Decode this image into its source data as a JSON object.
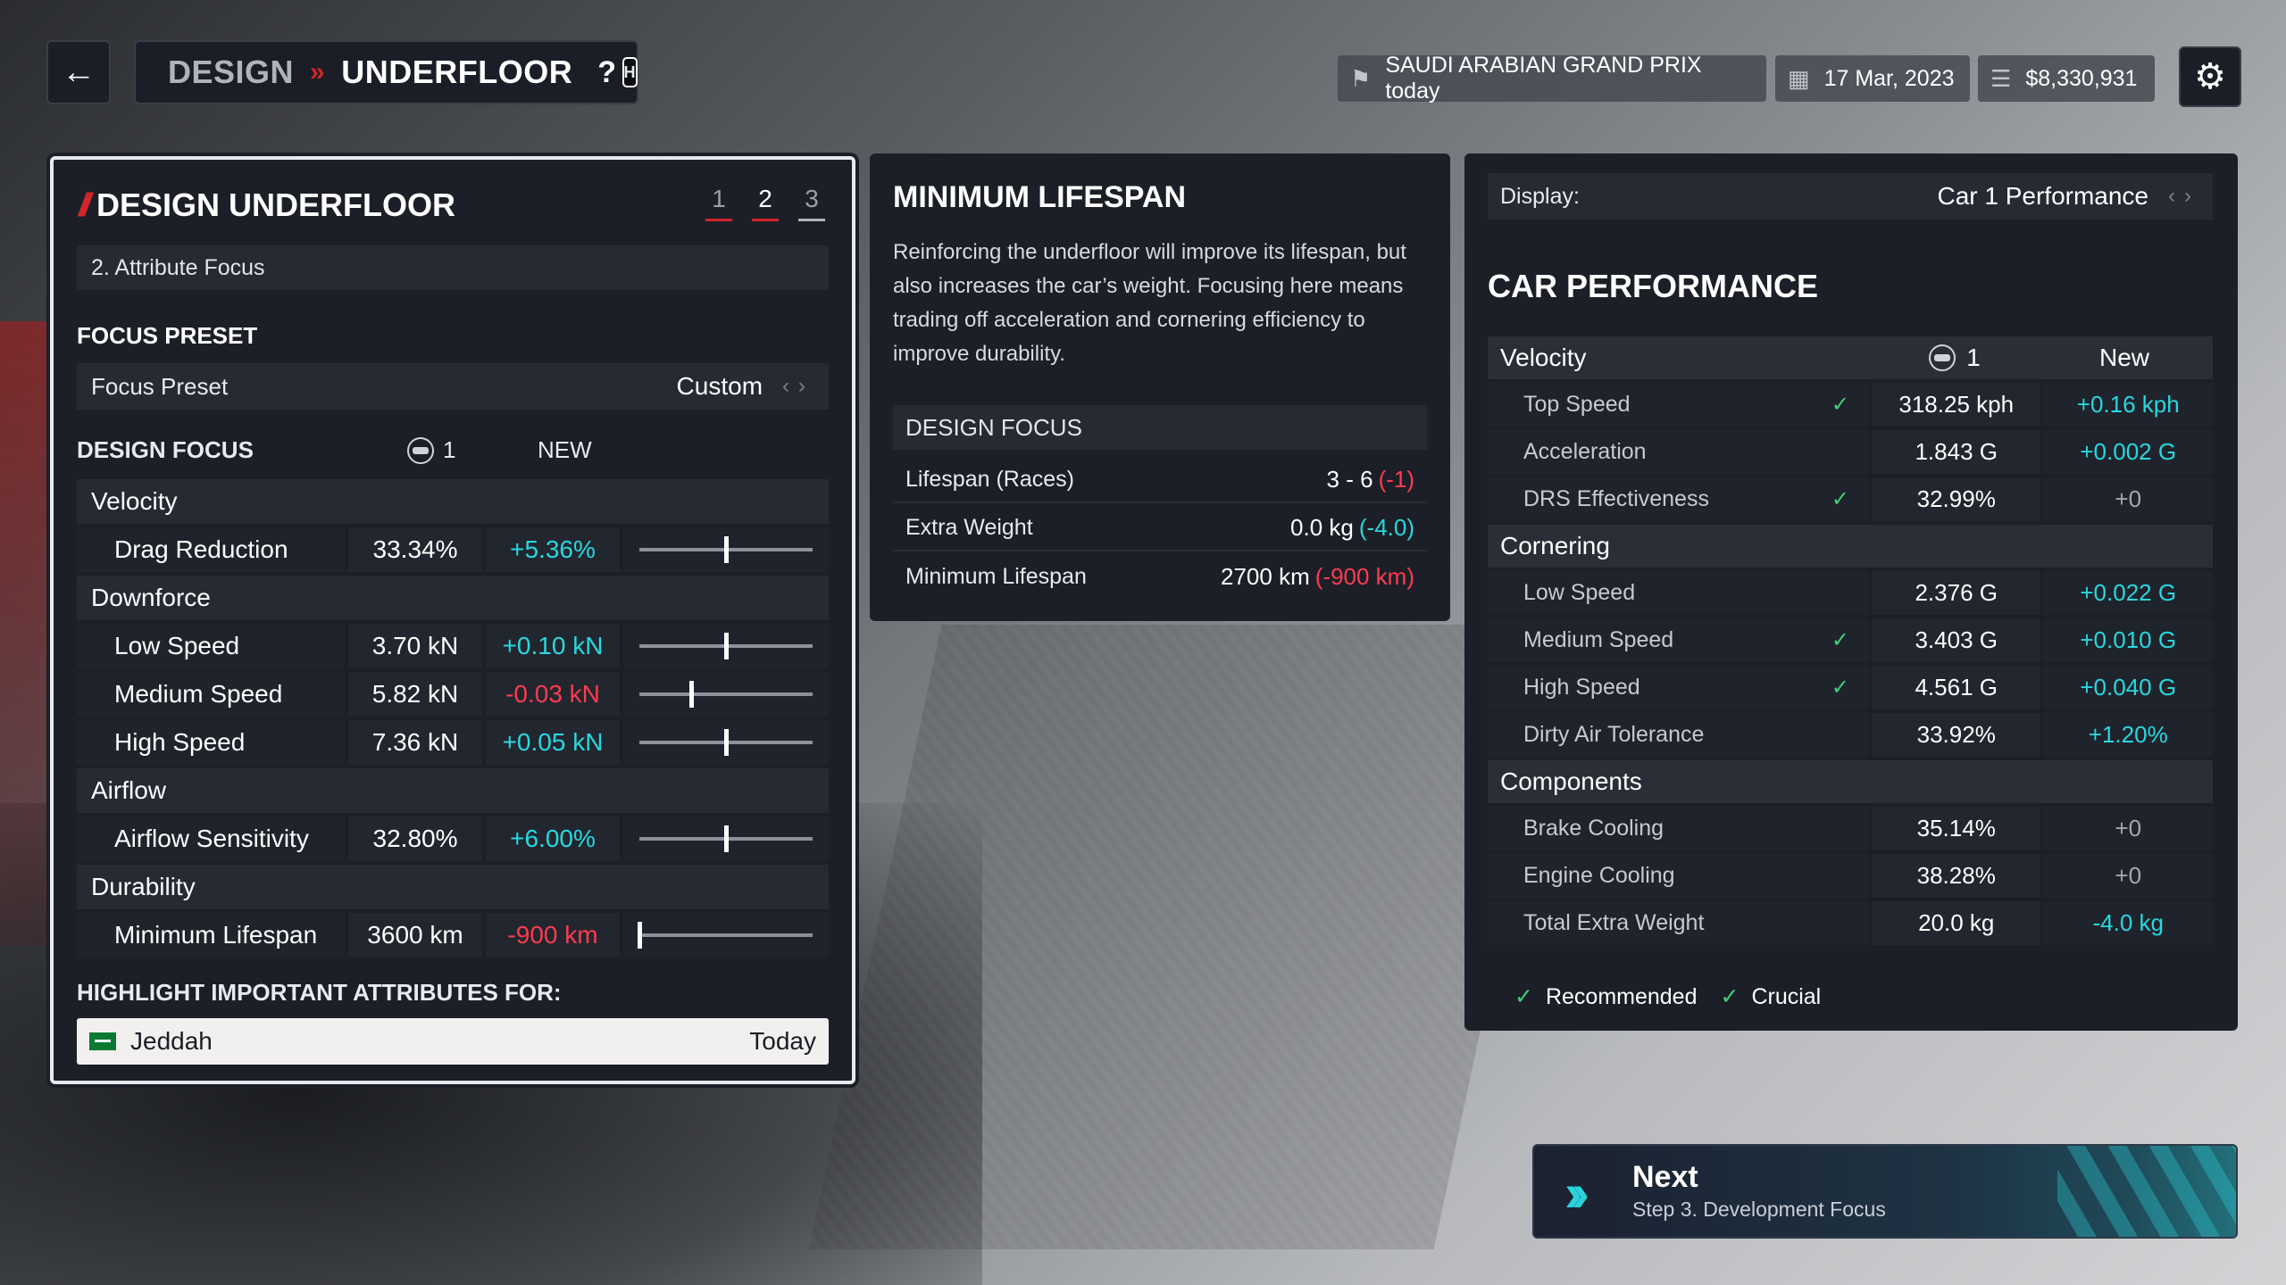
{
  "header": {
    "back_icon": "arrow-left-icon",
    "crumb1": "DESIGN",
    "separator": "»",
    "crumb2": "UNDERFLOOR",
    "help": "?",
    "help_key": "H",
    "event": "SAUDI ARABIAN GRAND PRIX today",
    "date": "17 Mar, 2023",
    "money": "$8,330,931",
    "settings_icon": "gear-icon"
  },
  "design_panel": {
    "title": "DESIGN UNDERFLOOR",
    "steps": [
      "1",
      "2",
      "3"
    ],
    "active_step": "2",
    "subhead": "2. Attribute Focus",
    "focus_preset_section": "FOCUS PRESET",
    "focus_preset_label": "Focus Preset",
    "focus_preset_value": "Custom",
    "design_focus_label": "DESIGN FOCUS",
    "driver_col": "1",
    "new_col": "NEW",
    "groups": [
      {
        "name": "Velocity",
        "rows": [
          {
            "name": "Drag Reduction",
            "base": "33.34%",
            "delta": "+5.36%",
            "trend": "pos",
            "slider": 0.5
          }
        ]
      },
      {
        "name": "Downforce",
        "rows": [
          {
            "name": "Low Speed",
            "base": "3.70 kN",
            "delta": "+0.10 kN",
            "trend": "pos",
            "slider": 0.5
          },
          {
            "name": "Medium Speed",
            "base": "5.82 kN",
            "delta": "-0.03 kN",
            "trend": "neg",
            "slider": 0.3
          },
          {
            "name": "High Speed",
            "base": "7.36 kN",
            "delta": "+0.05 kN",
            "trend": "pos",
            "slider": 0.5
          }
        ]
      },
      {
        "name": "Airflow",
        "rows": [
          {
            "name": "Airflow Sensitivity",
            "base": "32.80%",
            "delta": "+6.00%",
            "trend": "pos",
            "slider": 0.5
          }
        ]
      },
      {
        "name": "Durability",
        "rows": [
          {
            "name": "Minimum Lifespan",
            "base": "3600 km",
            "delta": "-900 km",
            "trend": "neg",
            "slider": 0.0
          }
        ]
      }
    ],
    "highlight_label": "HIGHLIGHT IMPORTANT ATTRIBUTES FOR:",
    "highlight_track": "Jeddah",
    "highlight_when": "Today"
  },
  "info_panel": {
    "title": "MINIMUM LIFESPAN",
    "description": "Reinforcing the underfloor will improve its lifespan, but also increases the car’s weight. Focusing here means trading off acceleration and cornering efficiency to improve durability.",
    "design_focus_label": "DESIGN FOCUS",
    "rows": [
      {
        "name": "Lifespan (Races)",
        "value": "3 - 6",
        "delta": "(-1)",
        "trend": "neg"
      },
      {
        "name": "Extra Weight",
        "value": "0.0 kg",
        "delta": "(-4.0)",
        "trend": "pos"
      },
      {
        "name": "Minimum Lifespan",
        "value": "2700 km",
        "delta": "(-900 km)",
        "trend": "neg"
      }
    ]
  },
  "performance_panel": {
    "display_label": "Display:",
    "display_value": "Car 1 Performance",
    "title": "CAR PERFORMANCE",
    "col_driver": "1",
    "col_new": "New",
    "groups": [
      {
        "name": "Velocity",
        "rows": [
          {
            "name": "Top Speed",
            "check": "recommended",
            "base": "318.25 kph",
            "new": "+0.16 kph",
            "trend": "pos"
          },
          {
            "name": "Acceleration",
            "check": "",
            "base": "1.843 G",
            "new": "+0.002 G",
            "trend": "pos"
          },
          {
            "name": "DRS Effectiveness",
            "check": "recommended",
            "base": "32.99%",
            "new": "+0",
            "trend": "neutral"
          }
        ]
      },
      {
        "name": "Cornering",
        "rows": [
          {
            "name": "Low Speed",
            "check": "",
            "base": "2.376 G",
            "new": "+0.022 G",
            "trend": "pos"
          },
          {
            "name": "Medium Speed",
            "check": "crucial",
            "base": "3.403 G",
            "new": "+0.010 G",
            "trend": "pos"
          },
          {
            "name": "High Speed",
            "check": "crucial",
            "base": "4.561 G",
            "new": "+0.040 G",
            "trend": "pos"
          },
          {
            "name": "Dirty Air Tolerance",
            "check": "",
            "base": "33.92%",
            "new": "+1.20%",
            "trend": "pos"
          }
        ]
      },
      {
        "name": "Components",
        "rows": [
          {
            "name": "Brake Cooling",
            "check": "",
            "base": "35.14%",
            "new": "+0",
            "trend": "neutral"
          },
          {
            "name": "Engine Cooling",
            "check": "",
            "base": "38.28%",
            "new": "+0",
            "trend": "neutral"
          },
          {
            "name": "Total Extra Weight",
            "check": "",
            "base": "20.0 kg",
            "new": "-4.0 kg",
            "trend": "pos"
          }
        ]
      }
    ],
    "legend_recommended": "Recommended",
    "legend_crucial": "Crucial"
  },
  "next": {
    "title": "Next",
    "subtitle": "Step 3. Development Focus"
  }
}
